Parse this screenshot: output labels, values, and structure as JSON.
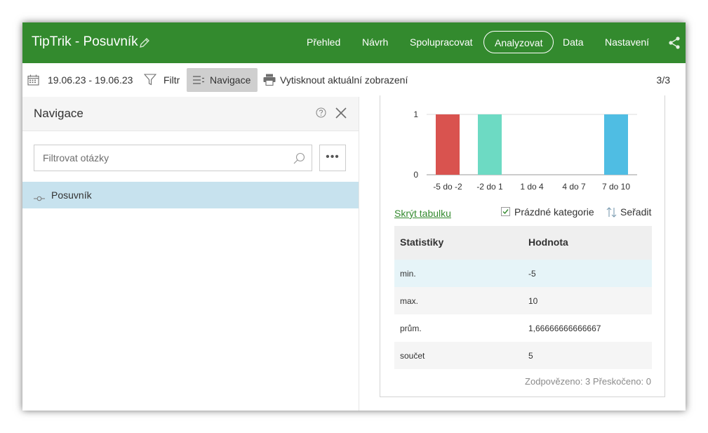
{
  "header": {
    "title": "TipTrik - Posuvník",
    "tabs": [
      {
        "label": "Přehled"
      },
      {
        "label": "Návrh"
      },
      {
        "label": "Spolupracovat"
      },
      {
        "label": "Analyzovat",
        "active": true
      },
      {
        "label": "Data"
      },
      {
        "label": "Nastavení"
      }
    ]
  },
  "toolbar": {
    "date_range": "19.06.23 - 19.06.23",
    "filter_label": "Filtr",
    "navigation_label": "Navigace",
    "print_label": "Vytisknout aktuální zobrazení",
    "counter": "3/3"
  },
  "left_panel": {
    "title": "Navigace",
    "filter_placeholder": "Filtrovat otázky",
    "more_label": "•••",
    "items": [
      {
        "label": "Posuvník",
        "selected": true
      }
    ]
  },
  "right_panel": {
    "hide_table_label": "Skrýt tabulku",
    "empty_categories_label": "Prázdné kategorie",
    "empty_categories_checked": true,
    "sort_label": "Seřadit",
    "table": {
      "headers": [
        "Statistiky",
        "Hodnota"
      ],
      "rows": [
        {
          "stat": "min.",
          "value": "-5"
        },
        {
          "stat": "max.",
          "value": "10"
        },
        {
          "stat": "prům.",
          "value": "1,66666666666667"
        },
        {
          "stat": "součet",
          "value": "5"
        }
      ]
    },
    "summary": "Zodpovězeno: 3  Přeskočeno: 0"
  },
  "colors": {
    "brand_green": "#338a2e",
    "selected_row": "#c7e2ee"
  },
  "chart_data": {
    "type": "bar",
    "categories": [
      "-5 do -2",
      "-2 do 1",
      "1 do 4",
      "4 do 7",
      "7 do 10"
    ],
    "values": [
      1,
      1,
      0,
      0,
      1
    ],
    "colors": [
      "#d9534f",
      "#6ddac3",
      "#e6a23c",
      "#9b59b6",
      "#4fbde3"
    ],
    "y_ticks": [
      "0",
      "1"
    ],
    "ylim": [
      0,
      1
    ],
    "grid": true
  }
}
